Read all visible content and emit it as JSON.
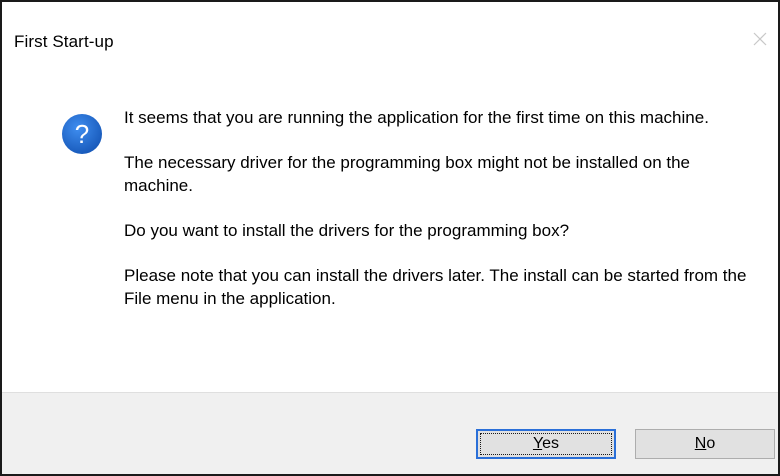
{
  "window": {
    "title": "First Start-up"
  },
  "icon": {
    "name": "question-icon",
    "glyph": "?",
    "color": "#1c68d4"
  },
  "message": {
    "paragraphs": [
      "It seems that you are running the application for the first time on this machine.",
      "The necessary driver for the programming box might not be installed on the machine.",
      "Do you want to install the drivers for the programming box?",
      "Please note that you can install the drivers later. The install can be started from the File menu in the application."
    ]
  },
  "buttons": {
    "yes": {
      "mnemonic": "Y",
      "rest": "es"
    },
    "no": {
      "mnemonic": "N",
      "rest": "o"
    }
  },
  "colors": {
    "footer_bg": "#f0f0f0",
    "button_bg": "#e1e1e1",
    "focus_border": "#2a6fd8"
  }
}
